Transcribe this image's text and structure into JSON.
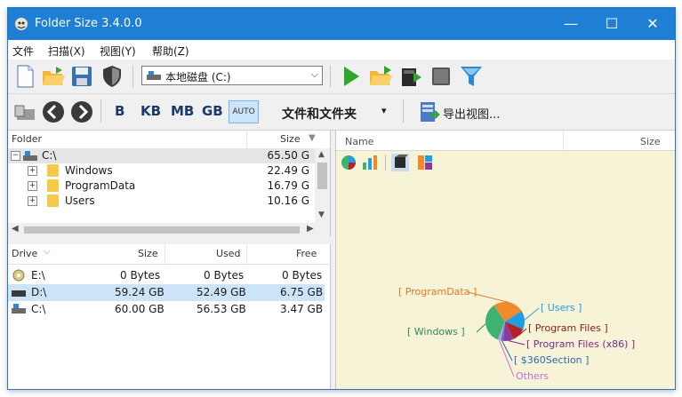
{
  "window": {
    "title": "Folder Size 3.4.0.0",
    "controls": {
      "minimize": "—",
      "maximize": "☐",
      "close": "✕"
    }
  },
  "menu": [
    {
      "label": "文件"
    },
    {
      "label": "扫描(X)"
    },
    {
      "label": "视图(Y)"
    },
    {
      "label": "帮助(Z)"
    }
  ],
  "toolbar": {
    "drive_select": "本地磁盘 (C:)",
    "unit_buttons": [
      "B",
      "KB",
      "MB",
      "GB"
    ],
    "auto_label": "AUTO",
    "view_mode": "文件和文件夹",
    "export_label": "导出视图..."
  },
  "folder_tree": {
    "headers": {
      "name": "Folder",
      "size": "Size"
    },
    "rows": [
      {
        "name": "C:\\",
        "size": "65.50 G",
        "level": 0
      },
      {
        "name": "Windows",
        "size": "22.49 G",
        "level": 1
      },
      {
        "name": "ProgramData",
        "size": "16.79 G",
        "level": 1
      },
      {
        "name": "Users",
        "size": "10.16 G",
        "level": 1
      }
    ]
  },
  "drives": {
    "headers": {
      "drive": "Drive",
      "size": "Size",
      "used": "Used",
      "free": "Free"
    },
    "rows": [
      {
        "drive": "E:\\",
        "size": "0 Bytes",
        "used": "0 Bytes",
        "free": "0 Bytes"
      },
      {
        "drive": "D:\\",
        "size": "59.24 GB",
        "used": "52.49 GB",
        "free": "6.75 GB"
      },
      {
        "drive": "C:\\",
        "size": "60.00 GB",
        "used": "56.53 GB",
        "free": "3.47 GB"
      }
    ]
  },
  "right_pane": {
    "headers": {
      "name": "Name",
      "size": "Size"
    }
  },
  "chart_data": {
    "type": "pie",
    "title": "",
    "categories": [
      "Windows",
      "ProgramData",
      "Users",
      "Program Files",
      "Program Files (x86)",
      "$360Section",
      "Others"
    ],
    "labels": [
      "[ Windows ]",
      "[ ProgramData ]",
      "[ Users ]",
      "[ Program Files ]",
      "[ Program Files (x86) ]",
      "[ $360Section ]",
      "Others"
    ],
    "values": [
      22.49,
      16.79,
      10.16,
      7.5,
      5.5,
      1.5,
      1.56
    ],
    "colors": [
      "#3cb371",
      "#f08a2c",
      "#1f9ee0",
      "#b5222a",
      "#8a3c9a",
      "#4a7ac9",
      "#d998e6"
    ],
    "label_colors": [
      "#2e8b57",
      "#e0782a",
      "#1f9ee0",
      "#8b1a1a",
      "#7a2a8a",
      "#2a6ab0",
      "#c070d8"
    ]
  }
}
